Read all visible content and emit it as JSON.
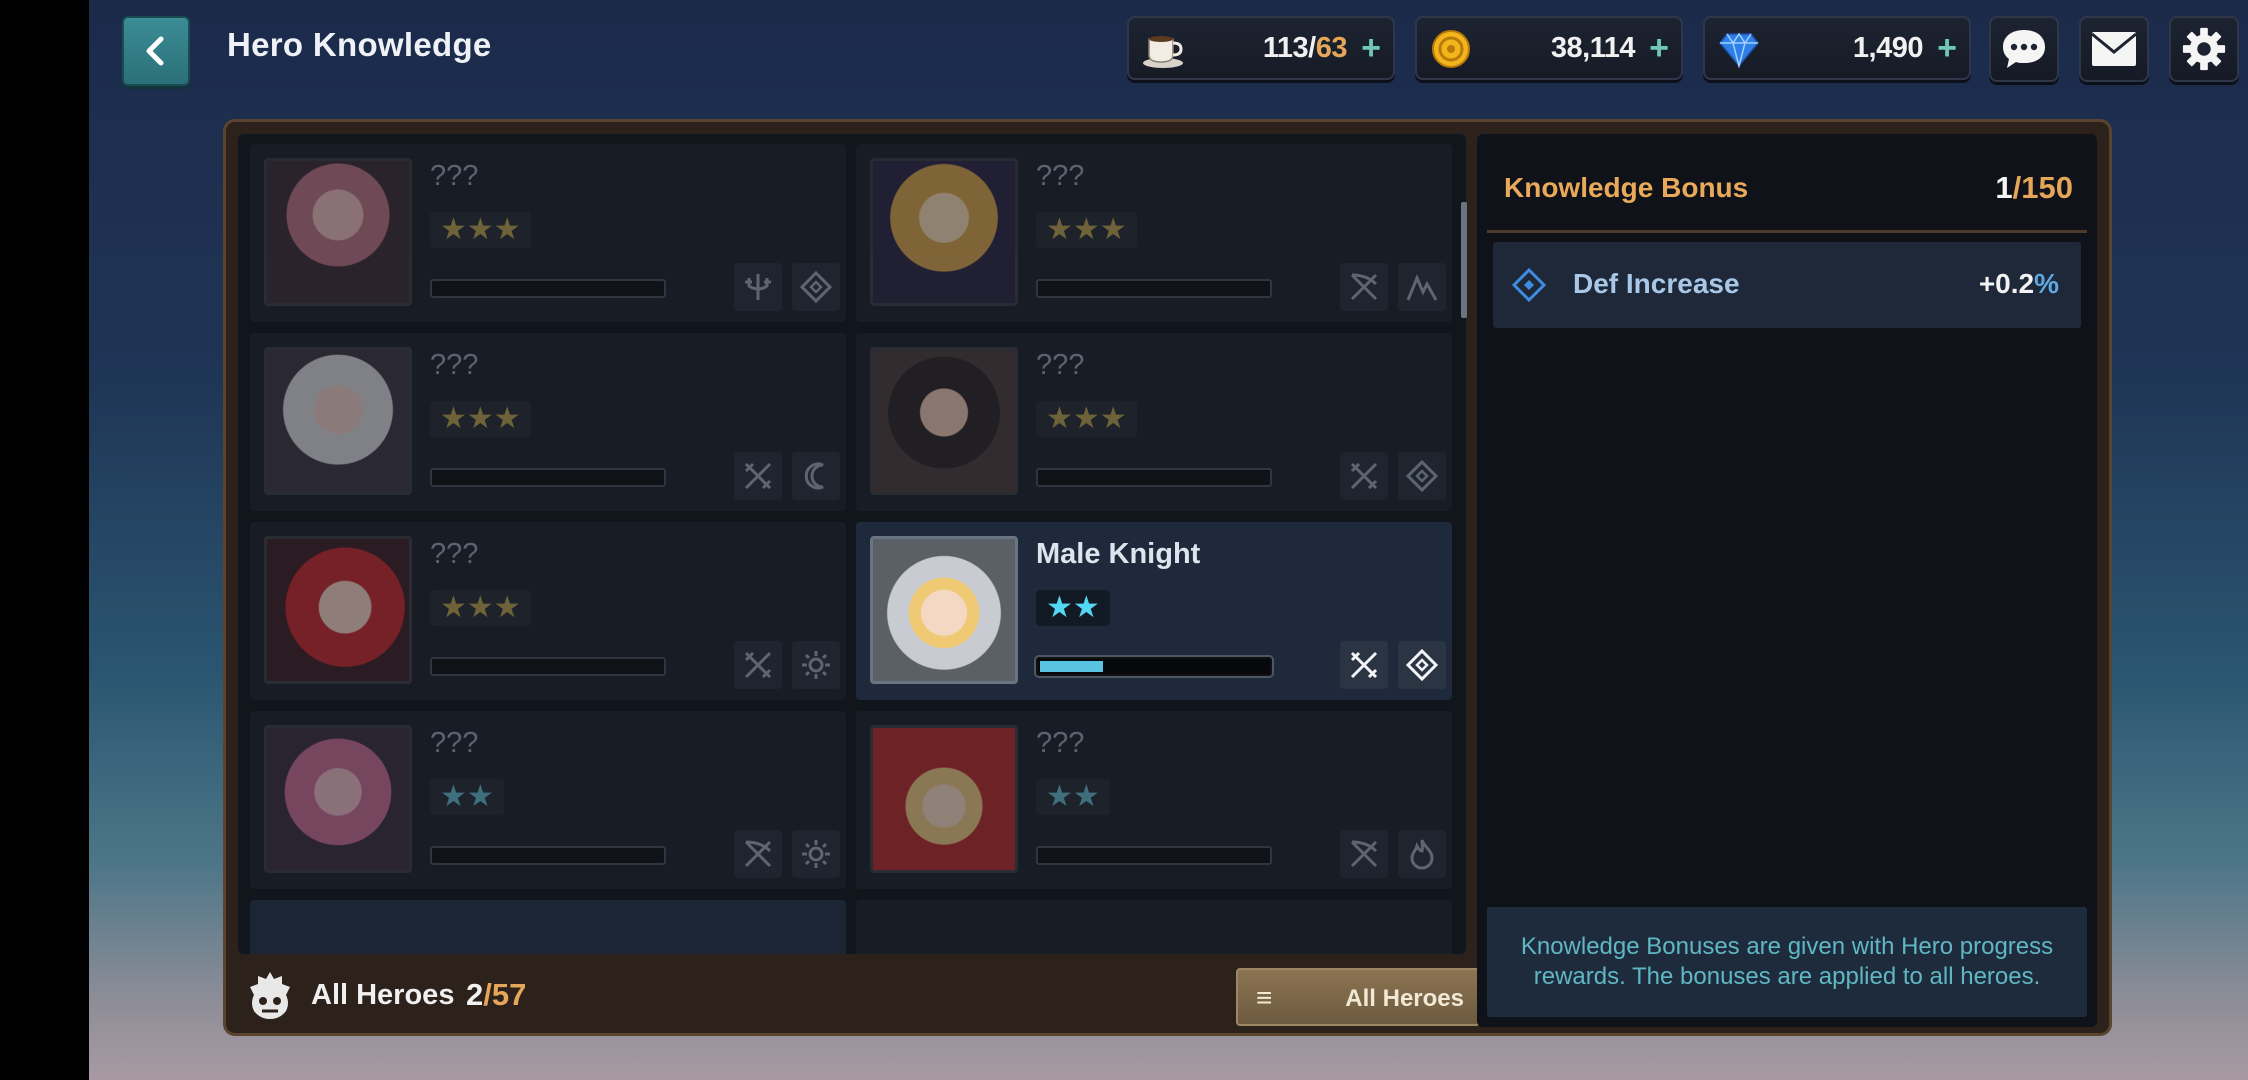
{
  "header": {
    "title": "Hero Knowledge",
    "resources": [
      {
        "icon": "coffee-cup-icon",
        "value": "113/",
        "max": "63"
      },
      {
        "icon": "gold-coin-icon",
        "value": "38,114",
        "max": ""
      },
      {
        "icon": "diamond-gem-icon",
        "value": "1,490",
        "max": ""
      }
    ],
    "plus": "+"
  },
  "heroes": [
    {
      "name": "???",
      "stars": "★★★",
      "star_color": "gold",
      "locked": true,
      "progress": 0,
      "class_icons": [
        "archer-trident-icon",
        "diamond-rune-icon"
      ]
    },
    {
      "name": "???",
      "stars": "★★★",
      "star_color": "gold",
      "locked": true,
      "progress": 0,
      "class_icons": [
        "crossed-bow-icon",
        "mountain-icon"
      ]
    },
    {
      "name": "???",
      "stars": "★★★",
      "star_color": "gold",
      "locked": true,
      "progress": 0,
      "class_icons": [
        "crossed-swords-icon",
        "crescent-moon-icon"
      ]
    },
    {
      "name": "???",
      "stars": "★★★",
      "star_color": "gold",
      "locked": true,
      "progress": 0,
      "class_icons": [
        "crossed-swords-icon",
        "diamond-rune-icon"
      ]
    },
    {
      "name": "???",
      "stars": "★★★",
      "star_color": "gold",
      "locked": true,
      "progress": 0,
      "class_icons": [
        "crossed-swords-icon",
        "sun-icon"
      ]
    },
    {
      "name": "Male Knight",
      "stars": "★★",
      "star_color": "blue",
      "locked": false,
      "progress": 0.27,
      "class_icons": [
        "crossed-swords-icon",
        "diamond-rune-icon"
      ]
    },
    {
      "name": "???",
      "stars": "★★",
      "star_color": "blue",
      "locked": true,
      "progress": 0,
      "class_icons": [
        "crossed-bow-icon",
        "sun-icon"
      ]
    },
    {
      "name": "???",
      "stars": "★★",
      "star_color": "blue",
      "locked": true,
      "progress": 0,
      "class_icons": [
        "crossed-bow-icon",
        "flame-icon"
      ]
    }
  ],
  "footer": {
    "label": "All Heroes",
    "count": "2",
    "max": "/57",
    "filter_menu_icon": "≡",
    "filter_label": "All Heroes"
  },
  "bonus": {
    "title": "Knowledge Bonus",
    "count": "1",
    "max": "/150",
    "rows": [
      {
        "stat": "Def Increase",
        "value": "+0.2",
        "unit": "%"
      }
    ],
    "note": "Knowledge Bonuses are given with Hero progress rewards. The bonuses are applied to all heroes."
  },
  "colors": {
    "accent_gold": "#e6a65a",
    "bonus_blue": "#5fa9e3",
    "teal_button": "#3c8d96"
  }
}
